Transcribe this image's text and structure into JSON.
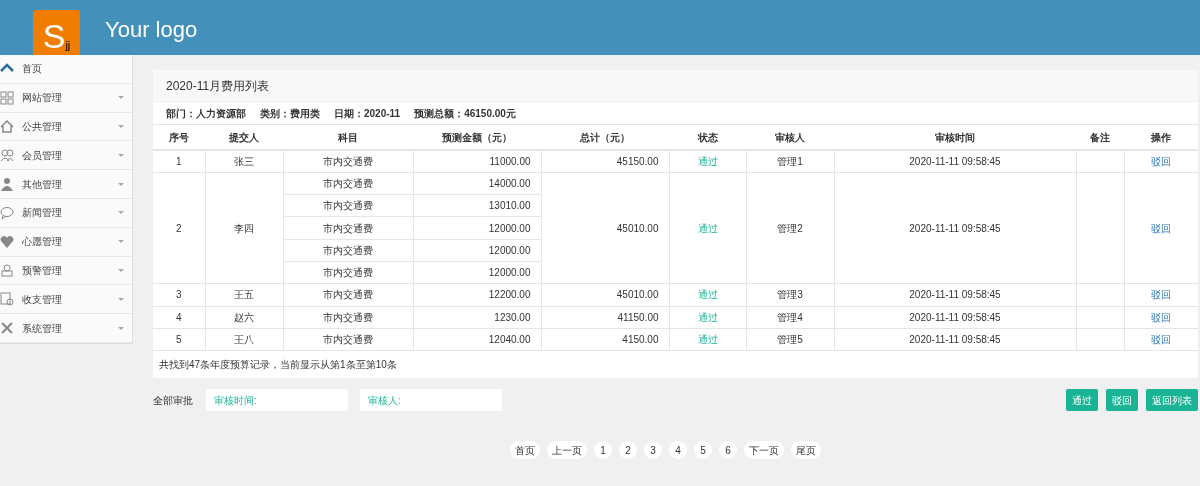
{
  "header": {
    "logo_mark": "S",
    "logo_sub": "jj",
    "logo_text": "Your logo"
  },
  "sidebar": {
    "items": [
      {
        "label": "首页",
        "expandable": false
      },
      {
        "label": "网站管理",
        "expandable": true
      },
      {
        "label": "公共管理",
        "expandable": true
      },
      {
        "label": "会员管理",
        "expandable": true
      },
      {
        "label": "其他管理",
        "expandable": true
      },
      {
        "label": "新闻管理",
        "expandable": true
      },
      {
        "label": "心愿管理",
        "expandable": true
      },
      {
        "label": "预警管理",
        "expandable": true
      },
      {
        "label": "收支管理",
        "expandable": true
      },
      {
        "label": "系统管理",
        "expandable": true
      }
    ]
  },
  "panel": {
    "title": "2020-11月费用列表",
    "info": [
      {
        "label": "部门：",
        "value": "人力资源部"
      },
      {
        "label": "类别：",
        "value": "费用类"
      },
      {
        "label": "日期：",
        "value": "2020-11"
      },
      {
        "label": "预测总额：",
        "value": "46150.00元"
      }
    ],
    "table": {
      "columns": [
        "序号",
        "提交人",
        "科目",
        "预测金额（元）",
        "总计（元）",
        "状态",
        "审核人",
        "审核时间",
        "备注",
        "操作"
      ],
      "rows": [
        {
          "no": "1",
          "submitter": "张三",
          "items": [
            {
              "subject": "市内交通费",
              "amount": "11000.00"
            }
          ],
          "total": "45150.00",
          "status": "通过",
          "reviewer": "管理1",
          "time": "2020-11-11 09:58:45",
          "action": "驳回"
        },
        {
          "no": "2",
          "submitter": "李四",
          "items": [
            {
              "subject": "市内交通费",
              "amount": "14000.00"
            },
            {
              "subject": "市内交通费",
              "amount": "13010.00"
            },
            {
              "subject": "市内交通费",
              "amount": "12000.00"
            },
            {
              "subject": "市内交通费",
              "amount": "12000.00"
            },
            {
              "subject": "市内交通费",
              "amount": "12000.00"
            }
          ],
          "total": "45010.00",
          "status": "通过",
          "reviewer": "管理2",
          "time": "2020-11-11 09:58:45",
          "action": "驳回"
        },
        {
          "no": "3",
          "submitter": "王五",
          "items": [
            {
              "subject": "市内交通费",
              "amount": "12200.00"
            }
          ],
          "total": "45010.00",
          "status": "通过",
          "reviewer": "管理3",
          "time": "2020-11-11 09:58:45",
          "action": "驳回"
        },
        {
          "no": "4",
          "submitter": "赵六",
          "items": [
            {
              "subject": "市内交通费",
              "amount": "1230.00"
            }
          ],
          "total": "41150.00",
          "status": "通过",
          "reviewer": "管理4",
          "time": "2020-11-11 09:58:45",
          "action": "驳回"
        },
        {
          "no": "5",
          "submitter": "王八",
          "items": [
            {
              "subject": "市内交通费",
              "amount": "12040.00"
            }
          ],
          "total": "4150.00",
          "status": "通过",
          "reviewer": "管理5",
          "time": "2020-11-11 09:58:45",
          "action": "驳回"
        }
      ]
    },
    "footer_note": "共找到47条年度预算记录，当前显示从第1条至第10条"
  },
  "approval": {
    "label": "全部审批",
    "fields": [
      {
        "placeholder": "审核时间:"
      },
      {
        "placeholder": "审核人:"
      }
    ],
    "buttons": [
      "通过",
      "驳回",
      "返回列表"
    ]
  },
  "pagination": [
    "首页",
    "上一页",
    "1",
    "2",
    "3",
    "4",
    "5",
    "6",
    "下一页",
    "尾页"
  ]
}
